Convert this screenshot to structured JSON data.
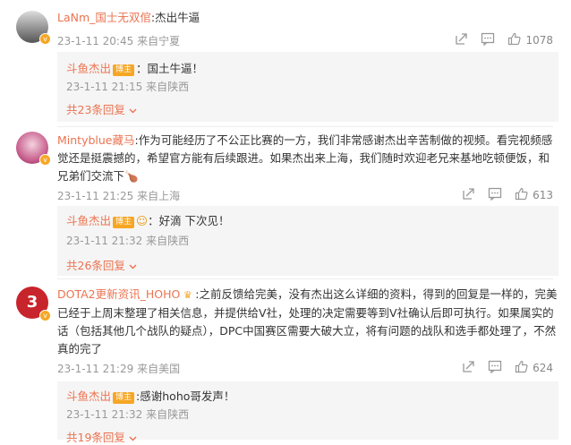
{
  "comments": [
    {
      "username": "LaNm_国士无双倌",
      "text": ":杰出牛逼",
      "time": "23-1-11 20:45",
      "location": "来自宁夏",
      "likes": "1078",
      "reply": {
        "username": "斗鱼杰出",
        "badge": "博主",
        "text": "：国土牛逼！",
        "time": "23-1-11 21:15",
        "location": "来自陕西",
        "more": "共23条回复"
      }
    },
    {
      "username": "Mintyblue藏马",
      "text": ":作为可能经历了不公正比赛的一方，我们非常感谢杰出辛苦制做的视频。看完视频感觉还是挺震撼的，希望官方能有后续跟进。如果杰出来上海，我们随时欢迎老兄来基地吃顿便饭，和兄弟们交流下",
      "time": "23-1-11 21:25",
      "location": "来自上海",
      "likes": "613",
      "reply": {
        "username": "斗鱼杰出",
        "badge": "博主",
        "text": "：好滴 下次见！",
        "time": "23-1-11 21:32",
        "location": "来自陕西",
        "more": "共26条回复"
      }
    },
    {
      "username": "DOTA2更新资讯_HOHO",
      "text": ":之前反馈给完美，没有杰出这么详细的资料，得到的回复是一样的，完美已经于上周末整理了相关信息，并提供给V社，处理的决定需要等到V社确认后即可执行。如果属实的话（包括其他几个战队的疑点），DPC中国赛区需要大破大立，将有问题的战队和选手都处理了，不然真的完了",
      "time": "23-1-11 21:29",
      "location": "来自美国",
      "likes": "624",
      "reply": {
        "username": "斗鱼杰出",
        "badge": "博主",
        "text": ":感谢hoho哥发声！",
        "time": "23-1-11 21:32",
        "location": "来自陕西",
        "more": "共19条回复"
      }
    }
  ],
  "icons": [
    "share-icon",
    "comment-icon",
    "like-icon",
    "chevron-down-icon",
    "verified-icon",
    "emoji-icon"
  ],
  "colors": {
    "accent": "#eb7350",
    "meta": "#999999",
    "reply_bg": "#f5f5f5",
    "badge": "#f6a623"
  }
}
